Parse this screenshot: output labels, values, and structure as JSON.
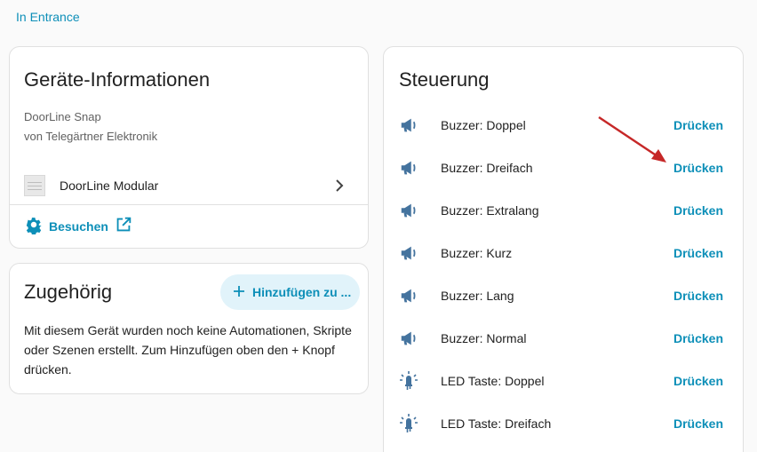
{
  "breadcrumb": "In Entrance",
  "info": {
    "title": "Geräte-Informationen",
    "model": "DoorLine Snap",
    "maker": "von Telegärtner Elektronik",
    "device_name": "DoorLine Modular",
    "visit_label": "Besuchen"
  },
  "related": {
    "title": "Zugehörig",
    "add_label": "Hinzufügen zu ...",
    "text": "Mit diesem Gerät wurden noch keine Automationen, Skripte oder Szenen erstellt. Zum Hinzufügen oben den + Knopf drücken."
  },
  "control": {
    "title": "Steuerung",
    "items": [
      {
        "label": "Buzzer: Doppel",
        "action": "Drücken",
        "icon": "bullhorn-icon"
      },
      {
        "label": "Buzzer: Dreifach",
        "action": "Drücken",
        "icon": "bullhorn-icon"
      },
      {
        "label": "Buzzer: Extralang",
        "action": "Drücken",
        "icon": "bullhorn-icon"
      },
      {
        "label": "Buzzer: Kurz",
        "action": "Drücken",
        "icon": "bullhorn-icon"
      },
      {
        "label": "Buzzer: Lang",
        "action": "Drücken",
        "icon": "bullhorn-icon"
      },
      {
        "label": "Buzzer: Normal",
        "action": "Drücken",
        "icon": "bullhorn-icon"
      },
      {
        "label": "LED Taste: Doppel",
        "action": "Drücken",
        "icon": "led-icon"
      },
      {
        "label": "LED Taste: Dreifach",
        "action": "Drücken",
        "icon": "led-icon"
      }
    ]
  },
  "colors": {
    "accent": "#0d8fb8",
    "icon": "#44739e",
    "arrow": "#c62828"
  }
}
